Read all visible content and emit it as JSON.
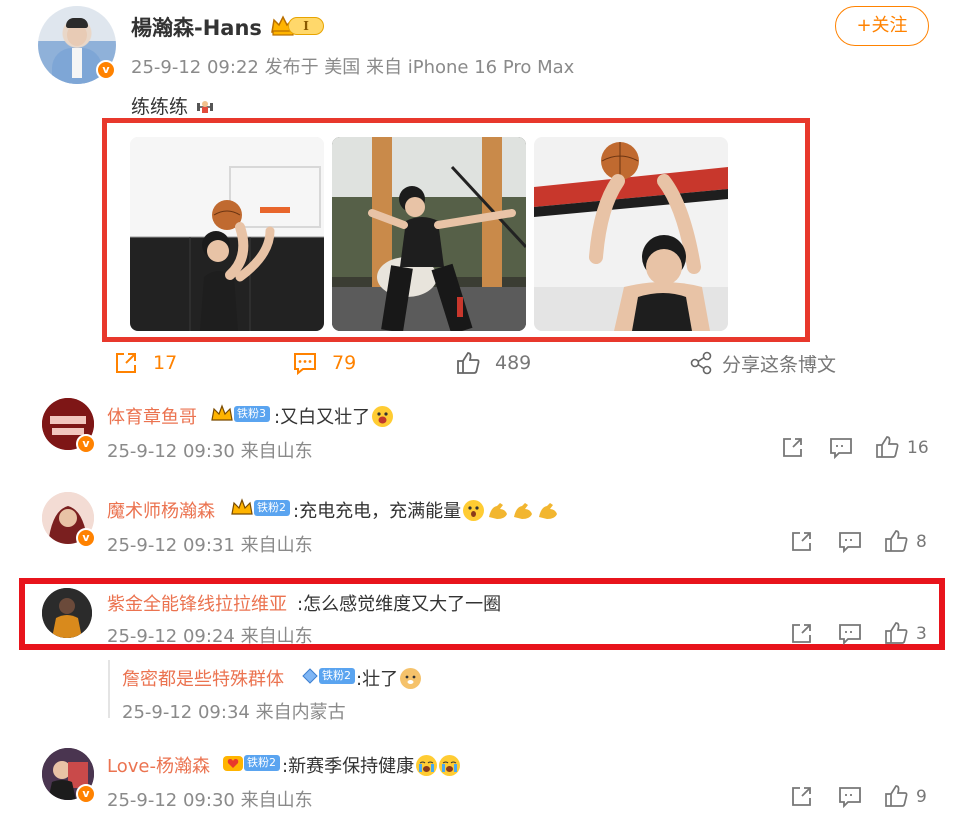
{
  "post": {
    "author": "楊瀚森-Hans",
    "level_badge": "I",
    "meta": "25-9-12 09:22  发布于 美国  来自 iPhone 16 Pro Max",
    "text": "练练练",
    "follow_label": "+关注",
    "images": [
      {
        "desc-icon": "photo-shooting-practice"
      },
      {
        "desc-icon": "photo-gym-stretch"
      },
      {
        "desc-icon": "photo-ball-overhead"
      }
    ],
    "actions": {
      "repost_count": "17",
      "comment_count": "79",
      "like_count": "489",
      "share_label": "分享这条博文"
    }
  },
  "comments": [
    {
      "name": "体育章鱼哥",
      "fan_badge": "铁粉3",
      "text": ":又白又壮了",
      "meta": "25-9-12 09:30  来自山东",
      "likes": "16",
      "avatar_text": "体育\n章鱼哥"
    },
    {
      "name": "魔术师杨瀚森",
      "fan_badge": "铁粉2",
      "text": ":充电充电，充满能量",
      "meta": "25-9-12 09:31  来自山东",
      "likes": "8"
    },
    {
      "name": "紫金全能锋线拉拉维亚",
      "text": ":怎么感觉维度又大了一圈",
      "meta": "25-9-12 09:24  来自山东",
      "likes": "3",
      "reply": {
        "name": "詹密都是些特殊群体",
        "fan_badge": "铁粉2",
        "text": ":壮了",
        "meta": "25-9-12 09:34  来自内蒙古"
      }
    },
    {
      "name": "Love-杨瀚森",
      "fan_badge": "铁粉2",
      "text": ":新赛季保持健康",
      "meta": "25-9-12 09:30  来自山东",
      "likes": "9"
    }
  ],
  "colors": {
    "accent": "#ff8200",
    "username": "#eb7350",
    "highlight_box": "#e8382c",
    "fan_badge": "#5aa4f0"
  }
}
